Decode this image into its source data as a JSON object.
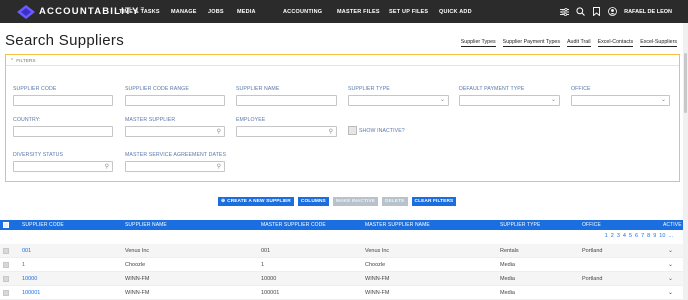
{
  "nav": {
    "logo_text": "ACCOUNTABILITY",
    "logo_tm": "™",
    "items": [
      {
        "label": "TIME & TASKS"
      },
      {
        "label": "MANAGE"
      },
      {
        "label": "JOBS"
      },
      {
        "label": "MEDIA"
      },
      {
        "label": "ACCOUNTING"
      },
      {
        "label": "MASTER FILES"
      },
      {
        "label": "SET UP FILES"
      },
      {
        "label": "QUICK ADD"
      }
    ],
    "user_name": "RAFAEL DE LEON",
    "right_icons": [
      "sliders-icon",
      "search-icon",
      "bookmark-icon",
      "user-icon"
    ]
  },
  "header": {
    "title": "Search Suppliers",
    "links": [
      "Supplier Types",
      "Supplier Payment Types",
      "Audit Trail",
      "Excel-Contacts",
      "Excel-Suppliers"
    ]
  },
  "filters": {
    "toggle_label": "FILTERS",
    "fields": {
      "supplier_code": {
        "label": "SUPPLIER CODE",
        "value": ""
      },
      "supplier_code_range": {
        "label": "SUPPLIER CODE RANGE",
        "value": ""
      },
      "supplier_name": {
        "label": "SUPPLIER NAME",
        "value": ""
      },
      "supplier_type": {
        "label": "SUPPLIER TYPE",
        "value": ""
      },
      "default_payment_type": {
        "label": "DEFAULT PAYMENT TYPE",
        "value": ""
      },
      "office": {
        "label": "OFFICE",
        "value": ""
      },
      "country": {
        "label": "COUNTRY:",
        "value": ""
      },
      "master_supplier": {
        "label": "MASTER SUPPLIER",
        "value": ""
      },
      "employee": {
        "label": "EMPLOYEE",
        "value": ""
      },
      "show_inactive": {
        "label": "SHOW INACTIVE?",
        "checked": false
      },
      "diversity_status": {
        "label": "DIVERSITY STATUS",
        "value": ""
      },
      "msa_dates": {
        "label": "MASTER SERVICE AGREEMENT DATES",
        "value": ""
      }
    }
  },
  "actions": {
    "create": "CREATE A NEW SUPPLIER",
    "columns": "COLUMNS",
    "make_inactive": "MAKE INACTIVE",
    "delete": "DELETE",
    "clear_filters": "CLEAR FILTERS"
  },
  "table": {
    "columns": [
      "SUPPLIER CODE",
      "SUPPLIER NAME",
      "MASTER SUPPLIER CODE",
      "MASTER SUPPLIER NAME",
      "SUPPLIER TYPE",
      "OFFICE",
      "ACTIVE"
    ],
    "pager": [
      "1",
      "2",
      "3",
      "4",
      "5",
      "6",
      "7",
      "8",
      "9",
      "10",
      "..."
    ],
    "rows": [
      {
        "code": "001",
        "name": "Venus Inc",
        "master_code": "001",
        "master_name": "Venus Inc",
        "type": "Rentals",
        "office": "Portland"
      },
      {
        "code": "1",
        "name": "Choozle",
        "master_code": "1",
        "master_name": "Choozle",
        "type": "Media",
        "office": ""
      },
      {
        "code": "10000",
        "name": "WINN-FM",
        "master_code": "10000",
        "master_name": "WINN-FM",
        "type": "Media",
        "office": "Portland"
      },
      {
        "code": "100001",
        "name": "WINN-FM",
        "master_code": "100001",
        "master_name": "WINN-FM",
        "type": "Media",
        "office": ""
      }
    ]
  },
  "colors": {
    "nav_bg": "#2b2b2b",
    "accent": "#1a6ee0",
    "filter_border": "#f5c342",
    "label": "#5a77a8"
  }
}
